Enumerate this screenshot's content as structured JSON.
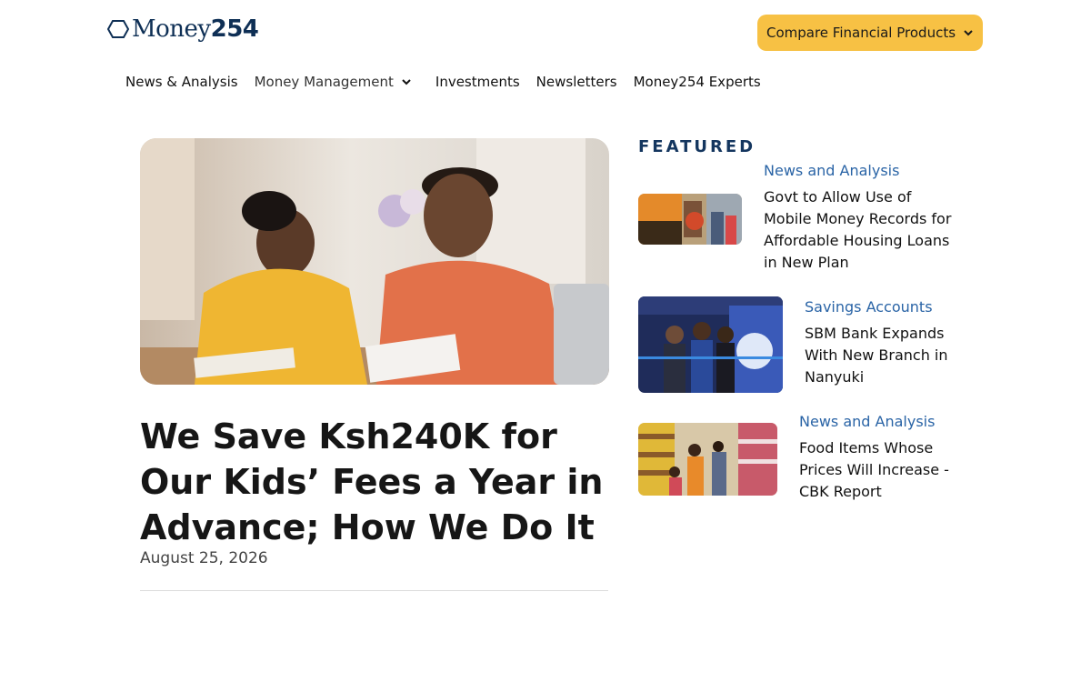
{
  "header": {
    "logo_text_word": "Money",
    "logo_text_number": "254",
    "compare_label": "Compare Financial Products",
    "brand_color": "#0e2f55",
    "accent_color": "#f7c144"
  },
  "nav": {
    "items": [
      {
        "label": "News & Analysis"
      },
      {
        "label": "Money Management",
        "has_dropdown": true
      },
      {
        "label": "Investments"
      },
      {
        "label": "Newsletters"
      },
      {
        "label": "Money254 Experts"
      }
    ]
  },
  "hero": {
    "title": "We Save Ksh240K for Our Kids’ Fees a Year in Advance; How We Do It",
    "date": "August 25, 2026"
  },
  "featured": {
    "heading": "FEATURED",
    "category_color": "#2a64a6",
    "items": [
      {
        "category": "News and Analysis",
        "title": "Govt to Allow Use of Mobile Money Records for Affordable Housing Loans in New Plan"
      },
      {
        "category": "Savings Accounts",
        "title": "SBM Bank Expands With New Branch in Nanyuki"
      },
      {
        "category": "News and Analysis",
        "title": "Food Items Whose Prices Will Increase - CBK Report"
      }
    ]
  },
  "icons": {
    "logo": "hexagon-logo-icon",
    "dropdown": "chevron-down-icon"
  }
}
